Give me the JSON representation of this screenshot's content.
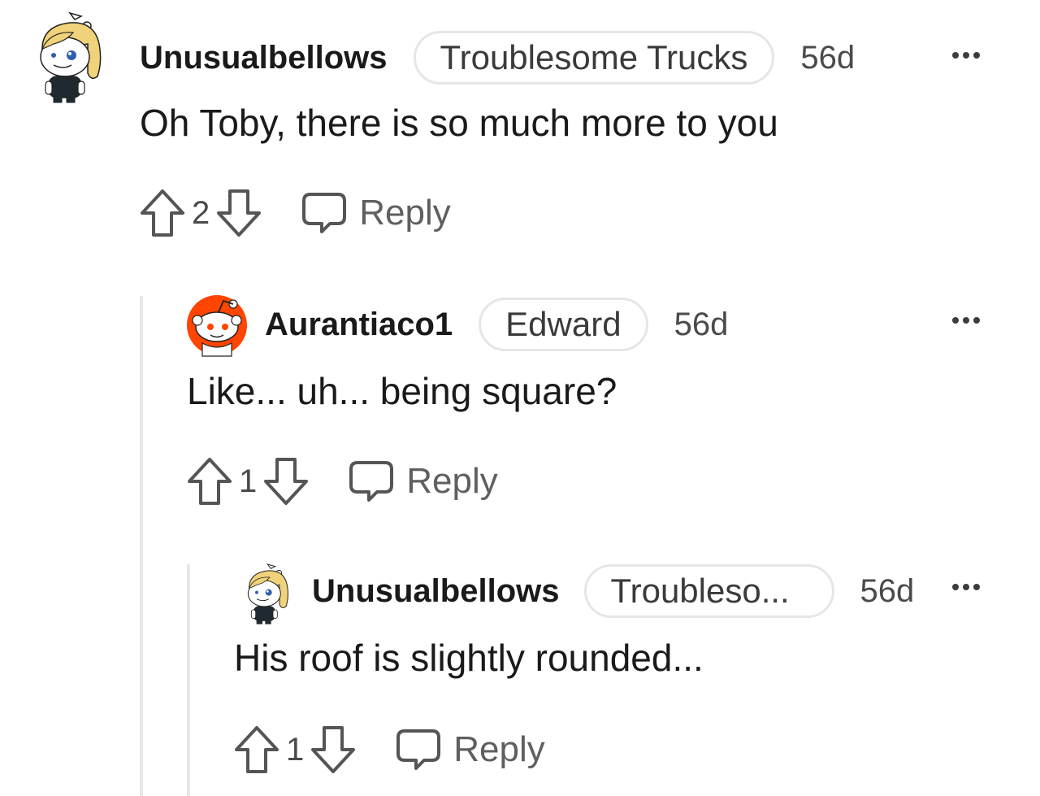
{
  "colors": {
    "text": "#1a1a1b",
    "muted": "#4a4a4a",
    "reddit_orange": "#ff4500",
    "flair_border": "#e6e6e6",
    "thread_line": "#e8e8e8"
  },
  "comments": [
    {
      "username": "Unusualbellows",
      "flair": "Troublesome Trucks",
      "time": "56d",
      "text": "Oh Toby, there is so much more to you",
      "score": "2",
      "reply_label": "Reply",
      "avatar_icon": "blonde-avatar-icon"
    },
    {
      "username": "Aurantiaco1",
      "flair": "Edward",
      "time": "56d",
      "text": "Like... uh... being square?",
      "score": "1",
      "reply_label": "Reply",
      "avatar_icon": "snoo-avatar-icon"
    },
    {
      "username": "Unusualbellows",
      "flair": "Troubleso...",
      "time": "56d",
      "text": "His roof is slightly rounded...",
      "score": "1",
      "reply_label": "Reply",
      "avatar_icon": "blonde-avatar-icon"
    }
  ]
}
